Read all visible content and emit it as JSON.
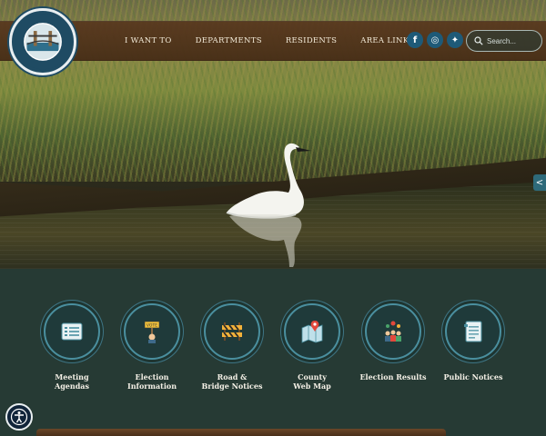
{
  "header": {
    "logo_alt": "Clearwater County Established 1913",
    "nav": [
      {
        "label": "I WANT TO"
      },
      {
        "label": "DEPARTMENTS"
      },
      {
        "label": "RESIDENTS"
      },
      {
        "label": "AREA LINKS"
      }
    ],
    "social": [
      {
        "name": "facebook-icon",
        "glyph": "f"
      },
      {
        "name": "instagram-icon",
        "glyph": "◎"
      },
      {
        "name": "twitter-icon",
        "glyph": "✦"
      }
    ],
    "search": {
      "placeholder": "Search..."
    }
  },
  "quick_links": [
    {
      "label": "Meeting\nAgendas",
      "icon": "agenda-list-icon"
    },
    {
      "label": "Election Information",
      "icon": "vote-sign-icon"
    },
    {
      "label": "Road &\nBridge Notices",
      "icon": "road-barrier-icon"
    },
    {
      "label": "County\nWeb Map",
      "icon": "map-pin-icon"
    },
    {
      "label": "Election Results",
      "icon": "people-results-icon"
    },
    {
      "label": "Public Notices",
      "icon": "notice-document-icon"
    }
  ],
  "colors": {
    "header_brown": "#58381e",
    "icon_accent": "#4a8f9f",
    "section_bg": "#263a34",
    "social_blue": "#1e5a78"
  }
}
